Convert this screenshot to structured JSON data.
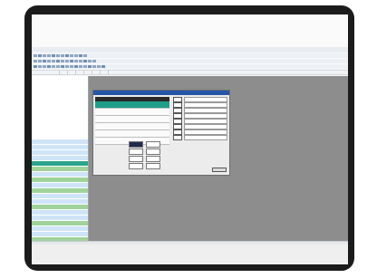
{
  "window": {
    "title": "",
    "status": ""
  },
  "tabs": [
    "",
    "",
    "",
    "",
    "",
    "",
    ""
  ],
  "tree": [
    "",
    "",
    "",
    "",
    "",
    "",
    "",
    "",
    ""
  ],
  "list_rows": [
    {
      "label": "",
      "color": "#cfe4f7"
    },
    {
      "label": "",
      "color": "#cfe4f7"
    },
    {
      "label": "",
      "color": "#cfe4f7"
    },
    {
      "label": "",
      "color": "#cfe4f7"
    },
    {
      "label": "",
      "color": "#2aa58c"
    },
    {
      "label": "",
      "color": "#9fd39a"
    },
    {
      "label": "",
      "color": "#cfe4f7"
    },
    {
      "label": "",
      "color": "#9fd39a"
    },
    {
      "label": "",
      "color": "#cfe4f7"
    },
    {
      "label": "",
      "color": "#9fd39a"
    },
    {
      "label": "",
      "color": "#cfe4f7"
    },
    {
      "label": "",
      "color": "#cfe4f7"
    },
    {
      "label": "",
      "color": "#9fd39a"
    },
    {
      "label": "",
      "color": "#cfe4f7"
    },
    {
      "label": "",
      "color": "#cfe4f7"
    },
    {
      "label": "",
      "color": "#9fd39a"
    },
    {
      "label": "",
      "color": "#cfe4f7"
    },
    {
      "label": "",
      "color": "#cfe4f7"
    },
    {
      "label": "",
      "color": "#9fd39a"
    },
    {
      "label": "",
      "color": "#cfe4f7"
    }
  ],
  "dialog": {
    "title": "",
    "headers": [
      "",
      "",
      ""
    ],
    "rows": [
      {
        "cells": [
          "",
          "",
          ""
        ],
        "selected": true
      },
      {
        "cells": [
          "",
          "",
          ""
        ],
        "selected": false
      },
      {
        "cells": [
          "",
          "",
          ""
        ],
        "selected": false
      },
      {
        "cells": [
          "",
          "",
          ""
        ],
        "selected": false
      },
      {
        "cells": [
          "",
          "",
          ""
        ],
        "selected": false
      },
      {
        "cells": [
          "",
          "",
          ""
        ],
        "selected": false
      }
    ],
    "right_fields": [
      "",
      "",
      "",
      "",
      "",
      "",
      "",
      ""
    ],
    "bottom_rows": [
      {
        "label": ""
      },
      {
        "label": ""
      },
      {
        "label": ""
      },
      {
        "label": ""
      }
    ],
    "ok_label": ""
  },
  "colors": {
    "workspace": "#8d8d8d",
    "accent": "#2457a8",
    "selection": "#1f9e8a"
  }
}
